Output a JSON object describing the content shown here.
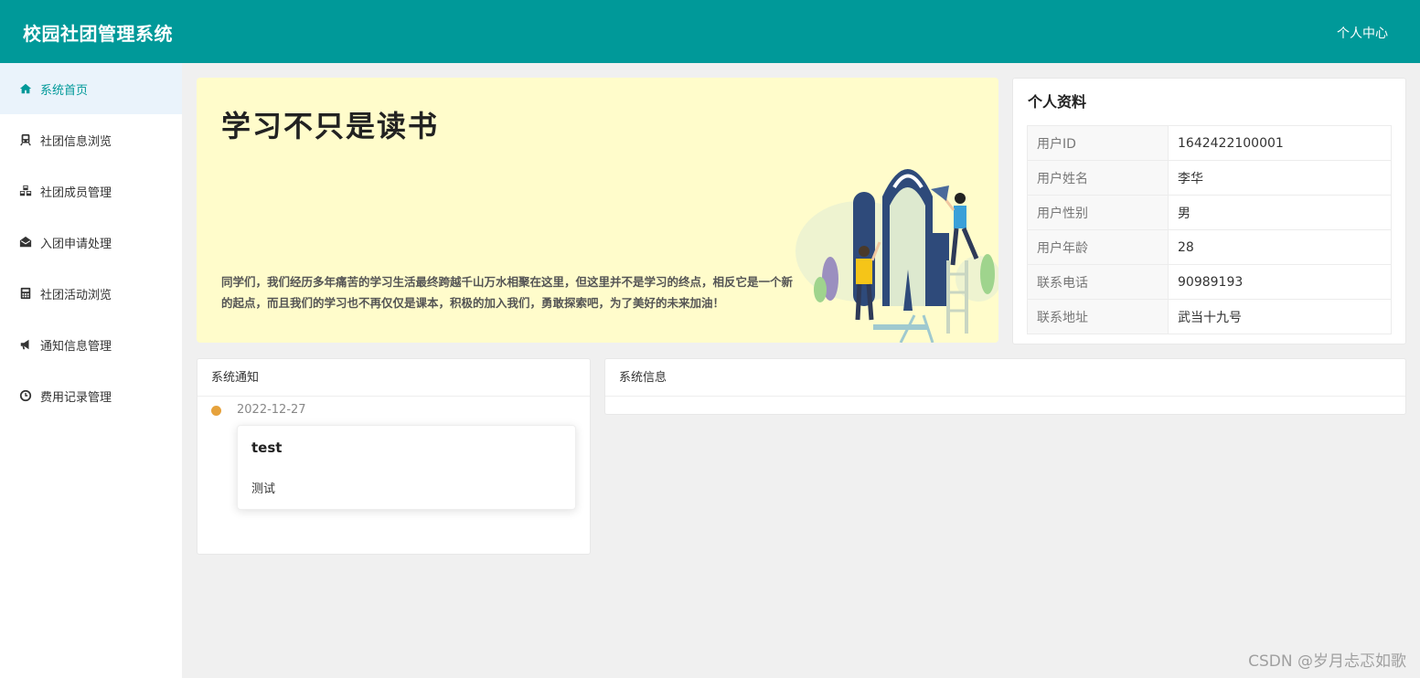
{
  "header": {
    "app_title": "校园社团管理系统",
    "user_center": "个人中心"
  },
  "sidebar": {
    "items": [
      {
        "label": "系统首页",
        "icon": "home-icon",
        "active": true
      },
      {
        "label": "社团信息浏览",
        "icon": "train-icon"
      },
      {
        "label": "社团成员管理",
        "icon": "cubes-icon"
      },
      {
        "label": "入团申请处理",
        "icon": "envelope-open-icon"
      },
      {
        "label": "社团活动浏览",
        "icon": "calculator-icon"
      },
      {
        "label": "通知信息管理",
        "icon": "bullhorn-icon"
      },
      {
        "label": "费用记录管理",
        "icon": "clock-icon"
      }
    ]
  },
  "banner": {
    "title": "学习不只是读书",
    "text": "同学们，我们经历多年痛苦的学习生活最终跨越千山万水相聚在这里，但这里并不是学习的终点，相反它是一个新的起点，而且我们的学习也不再仅仅是课本，积极的加入我们，勇敢探索吧，为了美好的未来加油！"
  },
  "profile": {
    "title": "个人资料",
    "rows": [
      {
        "key": "用户ID",
        "value": "1642422100001"
      },
      {
        "key": "用户姓名",
        "value": "李华"
      },
      {
        "key": "用户性别",
        "value": "男"
      },
      {
        "key": "用户年龄",
        "value": "28"
      },
      {
        "key": "联系电话",
        "value": "90989193"
      },
      {
        "key": "联系地址",
        "value": "武当十九号"
      }
    ]
  },
  "notice": {
    "header": "系统通知",
    "items": [
      {
        "date": "2022-12-27",
        "title": "test",
        "content": "测试"
      }
    ]
  },
  "system_info": {
    "header": "系统信息"
  },
  "watermark": "CSDN @岁月忐忑如歌",
  "colors": {
    "topbar": "#009999",
    "active_nav_bg": "#eaf3fb",
    "timeline_dot": "#e6a23c",
    "banner_bg": "#fffccb"
  }
}
